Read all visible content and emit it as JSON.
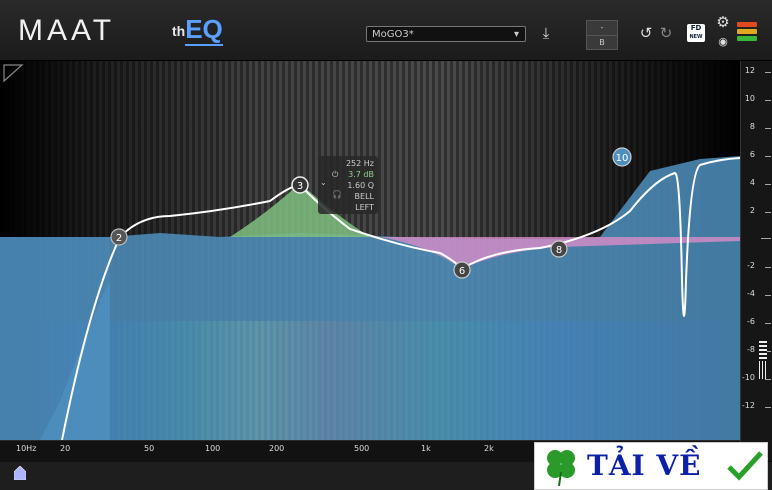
{
  "header": {
    "logo": "MAAT",
    "product": {
      "prefix": "th",
      "name": "EQ"
    },
    "preset_name": "MoGO3*",
    "ab_top": "-",
    "ab_bottom": "B",
    "fd_label_top": "FD",
    "fd_label_bottom": "NEW"
  },
  "colors": {
    "curve_fill": "#4e8fbe",
    "band_boost_green": "#7fbf7f",
    "band_cut_pink": "#d98cc8",
    "accent": "#5aa0ff"
  },
  "tooltip": {
    "freq": "252 Hz",
    "gain": "3.7 dB",
    "q": "1.60 Q",
    "type": "BELL",
    "channel": "LEFT"
  },
  "bands": [
    "2",
    "3",
    "6",
    "8",
    "10"
  ],
  "db_scale": [
    "12",
    "10",
    "8",
    "6",
    "4",
    "2",
    "-2",
    "-4",
    "-6",
    "-8",
    "-10",
    "-12"
  ],
  "freq_scale": [
    "10Hz",
    "20",
    "50",
    "100",
    "200",
    "500",
    "1k",
    "2k"
  ],
  "watermark": {
    "text": "TẢI VỀ"
  }
}
